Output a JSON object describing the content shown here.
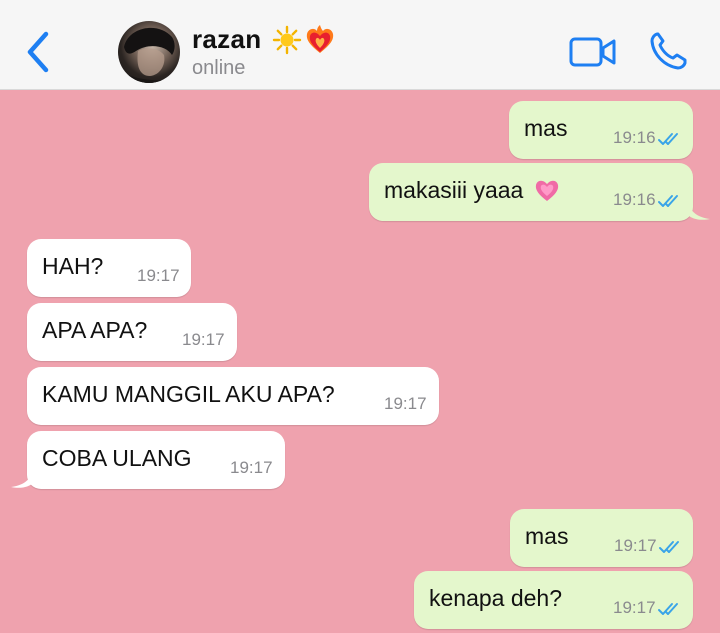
{
  "header": {
    "back_icon": "chevron-left-icon",
    "contact_name": "razan",
    "name_emojis": [
      "sun-emoji",
      "heart-on-fire-emoji"
    ],
    "status": "online",
    "video_icon": "video-camera-icon",
    "call_icon": "phone-icon"
  },
  "colors": {
    "chat_background": "#efa2ae",
    "outgoing_bubble": "#e4f7cc",
    "incoming_bubble": "#ffffff",
    "accent": "#1e7ff2",
    "read_ticks": "#3aa4e8"
  },
  "messages": [
    {
      "direction": "out",
      "text": "mas",
      "time": "19:16",
      "status": "read"
    },
    {
      "direction": "out",
      "text": "makasiii yaaa",
      "emoji": "heart-emoji",
      "time": "19:16",
      "status": "read"
    },
    {
      "direction": "in",
      "text": "HAH?",
      "time": "19:17"
    },
    {
      "direction": "in",
      "text": "APA APA?",
      "time": "19:17"
    },
    {
      "direction": "in",
      "text": "KAMU MANGGIL AKU APA?",
      "time": "19:17"
    },
    {
      "direction": "in",
      "text": "COBA ULANG",
      "time": "19:17"
    },
    {
      "direction": "out",
      "text": "mas",
      "time": "19:17",
      "status": "read"
    },
    {
      "direction": "out",
      "text": "kenapa deh?",
      "time": "19:17",
      "status": "read"
    }
  ]
}
